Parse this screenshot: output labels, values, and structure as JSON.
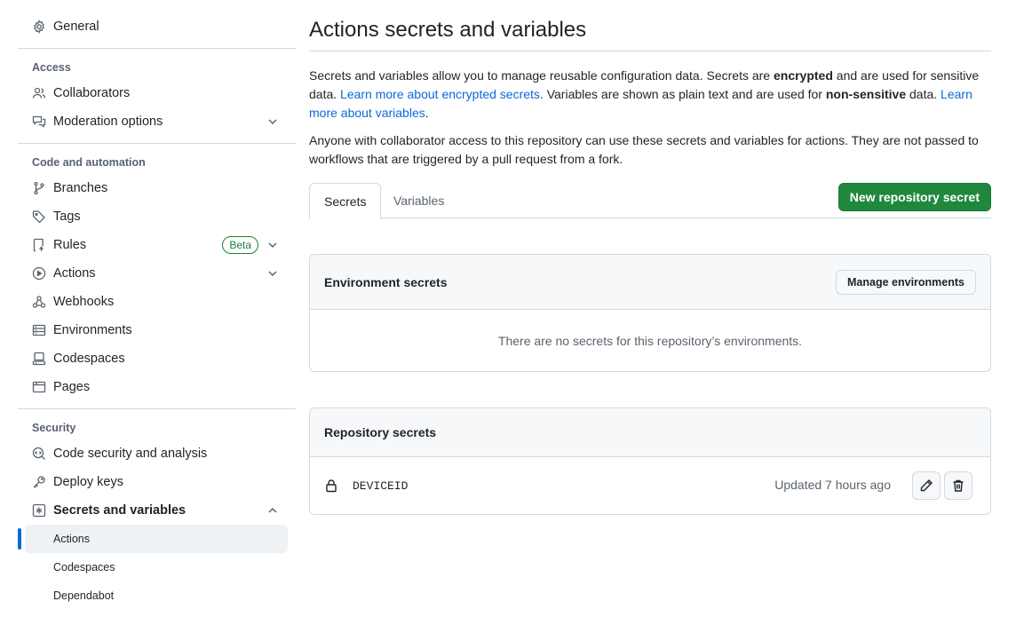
{
  "sidebar": {
    "general": "General",
    "access_heading": "Access",
    "collaborators": "Collaborators",
    "moderation": "Moderation options",
    "code_heading": "Code and automation",
    "branches": "Branches",
    "tags": "Tags",
    "rules": "Rules",
    "rules_badge": "Beta",
    "actions": "Actions",
    "webhooks": "Webhooks",
    "environments": "Environments",
    "codespaces": "Codespaces",
    "pages": "Pages",
    "security_heading": "Security",
    "code_security": "Code security and analysis",
    "deploy_keys": "Deploy keys",
    "secrets_vars": "Secrets and variables",
    "sub_actions": "Actions",
    "sub_codespaces": "Codespaces",
    "sub_dependabot": "Dependabot"
  },
  "main": {
    "title": "Actions secrets and variables",
    "p1_a": "Secrets and variables allow you to manage reusable configuration data. Secrets are ",
    "p1_b": "encrypted",
    "p1_c": " and are used for sensitive data. ",
    "p1_link1": "Learn more about encrypted secrets",
    "p1_d": ". Variables are shown as plain text and are used for ",
    "p1_e": "non-sensitive",
    "p1_f": " data. ",
    "p1_link2": "Learn more about variables",
    "p1_g": ".",
    "p2": "Anyone with collaborator access to this repository can use these secrets and variables for actions. They are not passed to workflows that are triggered by a pull request from a fork.",
    "tab_secrets": "Secrets",
    "tab_variables": "Variables",
    "new_secret_button": "New repository secret",
    "env_header": "Environment secrets",
    "manage_env_button": "Manage environments",
    "env_empty": "There are no secrets for this repository’s environments.",
    "repo_header": "Repository secrets",
    "secrets": [
      {
        "name": "DEVICEID",
        "updated": "Updated 7 hours ago"
      }
    ]
  },
  "colors": {
    "accent": "#0969da",
    "primary_button": "#1f883d",
    "badge_green": "#1a7f37"
  }
}
